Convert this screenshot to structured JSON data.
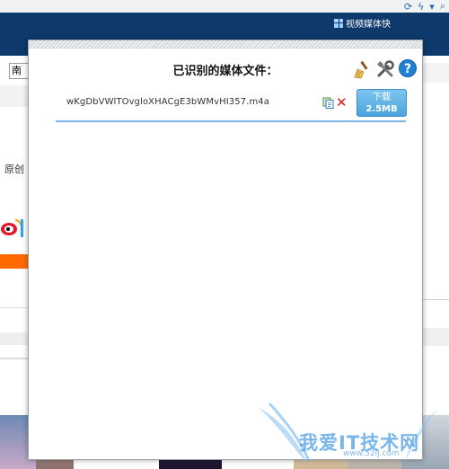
{
  "browser": {
    "extension_label": "视频媒体快"
  },
  "background": {
    "city_select": "南山",
    "side_label": "原创"
  },
  "panel": {
    "title": "已识别的媒体文件：",
    "tools": {
      "clean_icon": "broom-icon",
      "settings_icon": "tools-icon",
      "help_label": "?"
    },
    "files": [
      {
        "name": "wKgDbVWlTOvgloXHACgE3bWMvHI357.m4a",
        "download_label": "下载",
        "size": "2.5MB"
      }
    ]
  },
  "watermark": {
    "text": "我爱IT技术网",
    "url": "www.52ij.com"
  },
  "colors": {
    "brand_blue": "#0d3a6b",
    "accent_blue": "#4aa3dc",
    "delete_red": "#cc1d1d",
    "orange": "#ff6a00"
  }
}
